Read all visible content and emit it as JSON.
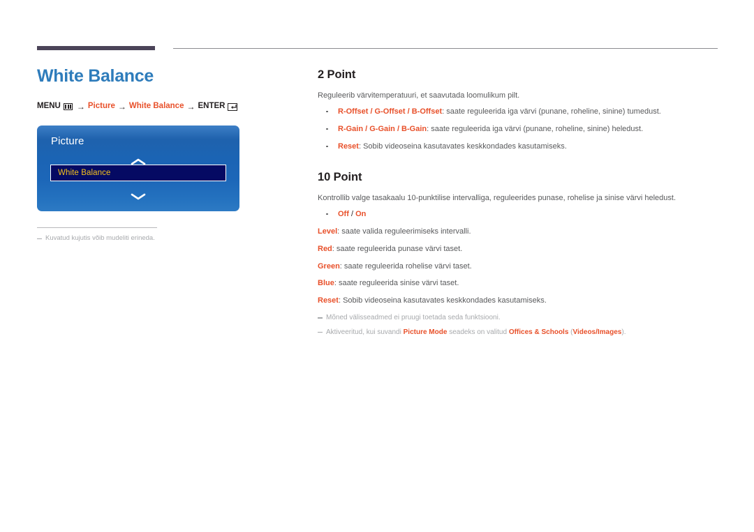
{
  "colors": {
    "title_blue": "#2e7cbb",
    "accent_orange": "#e8502a",
    "rule_dark": "#4b4458",
    "osd_highlight_navy": "#050a63",
    "osd_highlight_text": "#f5c21c",
    "note_gray": "#a7a9ac"
  },
  "left": {
    "page_title": "White Balance",
    "breadcrumb": {
      "menu_label": "MENU",
      "menu_icon": "menu-grid-icon",
      "arrow": "→",
      "item1": "Picture",
      "item2": "White Balance",
      "enter_label": "ENTER",
      "enter_icon": "enter-return-icon"
    },
    "osd": {
      "title": "Picture",
      "scroll_up_icon": "chevron-up-icon",
      "scroll_down_icon": "chevron-down-icon",
      "selected_item": "White Balance"
    },
    "note": "Kuvatud kujutis võib mudeliti erineda."
  },
  "right": {
    "section1": {
      "title": "2 Point",
      "intro": "Reguleerib värvitemperatuuri, et saavutada loomulikum pilt.",
      "bullets": [
        {
          "term": "R-Offset / G-Offset / B-Offset",
          "desc": ": saate reguleerida iga värvi (punane, roheline, sinine) tumedust."
        },
        {
          "term": "R-Gain / G-Gain / B-Gain",
          "desc": ": saate reguleerida iga värvi (punane, roheline, sinine) heledust."
        },
        {
          "term": "Reset",
          "desc": ": Sobib videoseina kasutavates keskkondades kasutamiseks."
        }
      ]
    },
    "section2": {
      "title": "10 Point",
      "intro": "Kontrollib valge tasakaalu 10-punktilise intervalliga, reguleerides punase, rohelise ja sinise värvi heledust.",
      "bullet_off": "Off",
      "bullet_sep": " / ",
      "bullet_on": "On",
      "definitions": [
        {
          "term": "Level",
          "desc": ": saate valida reguleerimiseks intervalli."
        },
        {
          "term": "Red",
          "desc": ": saate reguleerida punase värvi taset."
        },
        {
          "term": "Green",
          "desc": ": saate reguleerida rohelise värvi taset."
        },
        {
          "term": "Blue",
          "desc": ": saate reguleerida sinise värvi taset."
        },
        {
          "term": "Reset",
          "desc": ": Sobib videoseina kasutavates keskkondades kasutamiseks."
        }
      ],
      "note1": "Mõned välisseadmed ei pruugi toetada seda funktsiooni.",
      "note2_a": "Aktiveeritud, kui suvandi ",
      "note2_b": "Picture Mode",
      "note2_c": " seadeks on valitud ",
      "note2_d": "Offices & Schools",
      "note2_e": " (",
      "note2_f": "Videos/Images",
      "note2_g": ")."
    }
  }
}
